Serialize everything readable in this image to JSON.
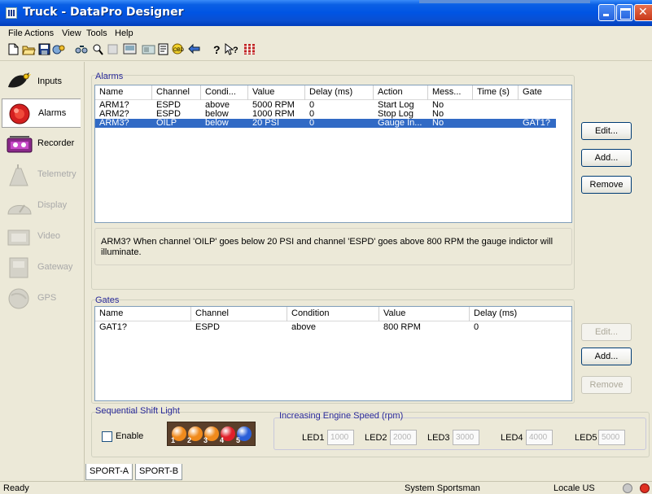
{
  "window": {
    "title": "Truck - DataPro Designer"
  },
  "menu": [
    "File",
    "Actions",
    "View",
    "Tools",
    "Help"
  ],
  "toolbar": {
    "icons": [
      "new-icon",
      "open-icon",
      "save-icon",
      "properties-icon",
      "connect-icon",
      "find-icon",
      "search-icon",
      "compile-icon",
      "device-icon",
      "report-icon",
      "obd-icon",
      "download-icon",
      "help-icon",
      "whats-this-icon",
      "about-icon"
    ]
  },
  "nav": {
    "items": [
      {
        "label": "Inputs",
        "state": "enabled"
      },
      {
        "label": "Alarms",
        "state": "selected"
      },
      {
        "label": "Recorder",
        "state": "enabled"
      },
      {
        "label": "Telemetry",
        "state": "disabled"
      },
      {
        "label": "Display",
        "state": "disabled"
      },
      {
        "label": "Video",
        "state": "disabled"
      },
      {
        "label": "Gateway",
        "state": "disabled"
      },
      {
        "label": "GPS",
        "state": "disabled"
      }
    ]
  },
  "alarms": {
    "group_label": "Alarms",
    "columns": [
      "Name",
      "Channel",
      "Condi...",
      "Value",
      "Delay (ms)",
      "Action",
      "Mess...",
      "Time (s)",
      "Gate"
    ],
    "rows": [
      {
        "name": "ARM1?",
        "channel": "ESPD",
        "condition": "above",
        "value": "5000 RPM",
        "delay": "0",
        "action": "Start Log",
        "message": "No",
        "time": "",
        "gate": ""
      },
      {
        "name": "ARM2?",
        "channel": "ESPD",
        "condition": "below",
        "value": "1000 RPM",
        "delay": "0",
        "action": "Stop Log",
        "message": "No",
        "time": "",
        "gate": ""
      },
      {
        "name": "ARM3?",
        "channel": "OILP",
        "condition": "below",
        "value": "20 PSI",
        "delay": "0",
        "action": "Gauge In...",
        "message": "No",
        "time": "",
        "gate": "GAT1?"
      }
    ],
    "buttons": {
      "edit": "Edit...",
      "add": "Add...",
      "remove": "Remove"
    },
    "description": "ARM3?  When channel 'OILP' goes below 20 PSI and channel 'ESPD' goes above 800 RPM the gauge indictor will illuminate."
  },
  "gates": {
    "group_label": "Gates",
    "columns": [
      "Name",
      "Channel",
      "Condition",
      "Value",
      "Delay (ms)"
    ],
    "rows": [
      {
        "name": "GAT1?",
        "channel": "ESPD",
        "condition": "above",
        "value": "800 RPM",
        "delay": "0"
      }
    ],
    "buttons": {
      "edit": "Edit...",
      "add": "Add...",
      "remove": "Remove"
    }
  },
  "shift_light": {
    "group_label": "Sequential Shift Light",
    "enable_label": "Enable",
    "enabled": false,
    "led_numbers": [
      "1",
      "2",
      "3",
      "4",
      "5"
    ],
    "led_colors": [
      "#f08a1c",
      "#f08a1c",
      "#f08a1c",
      "#e0202a",
      "#2a5fd8"
    ],
    "engine_speed_label": "Increasing Engine Speed (rpm)",
    "leds": [
      {
        "label": "LED1",
        "value": "1000"
      },
      {
        "label": "LED2",
        "value": "2000"
      },
      {
        "label": "LED3",
        "value": "3000"
      },
      {
        "label": "LED4",
        "value": "4000"
      },
      {
        "label": "LED5",
        "value": "5000"
      }
    ]
  },
  "tabs": [
    "SPORT-A",
    "SPORT-B"
  ],
  "status": {
    "left": "Ready",
    "system": "System  Sportsman",
    "locale": "Locale  US"
  }
}
